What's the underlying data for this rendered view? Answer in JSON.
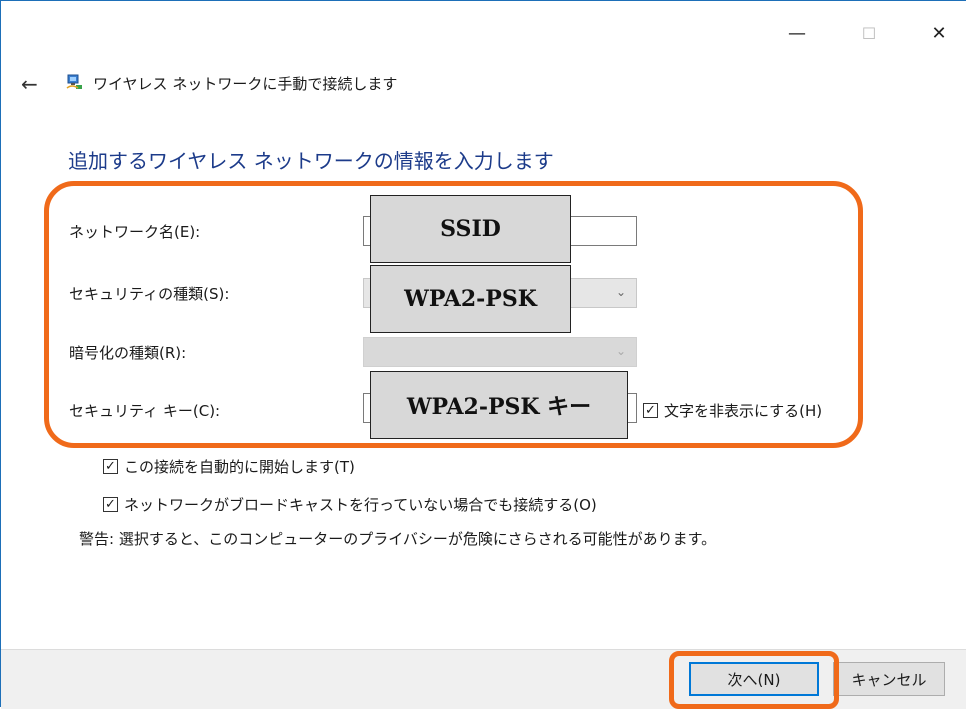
{
  "window": {
    "minimize_glyph": "—",
    "maximize_glyph": "☐",
    "close_glyph": "✕"
  },
  "header": {
    "back_glyph": "←",
    "title": "ワイヤレス ネットワークに手動で接続します"
  },
  "heading": "追加するワイヤレス ネットワークの情報を入力します",
  "form": {
    "network_name_label": "ネットワーク名(E):",
    "security_type_label": "セキュリティの種類(S):",
    "encryption_type_label": "暗号化の種類(R):",
    "security_key_label": "セキュリティ キー(C):",
    "hide_chars_label": "文字を非表示にする(H)",
    "hide_chars_checked": true
  },
  "annotations": {
    "ssid": "SSID",
    "security_type": "WPA2-PSK",
    "security_key": "WPA2-PSK キー"
  },
  "options": {
    "auto_connect_label": "この接続を自動的に開始します(T)",
    "auto_connect_checked": true,
    "connect_hidden_label": "ネットワークがブロードキャストを行っていない場合でも接続する(O)",
    "connect_hidden_checked": true,
    "warning": "警告: 選択すると、このコンピューターのプライバシーが危険にさらされる可能性があります。"
  },
  "footer": {
    "next_label": "次へ(N)",
    "cancel_label": "キャンセル"
  },
  "colors": {
    "highlight": "#f06a1a",
    "heading": "#1c3b8a",
    "primary_border": "#0078d7"
  },
  "icons": {
    "check": "✓",
    "chevron": "⌄"
  }
}
